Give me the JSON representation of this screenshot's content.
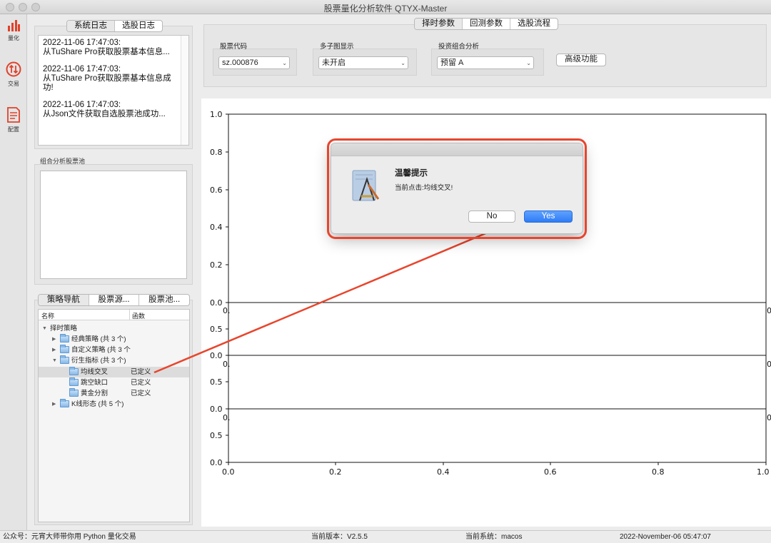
{
  "window": {
    "title": "股票量化分析软件 QTYX-Master"
  },
  "leftnav": [
    {
      "label": "量化",
      "icon": "bar-chart-icon"
    },
    {
      "label": "交易",
      "icon": "trade-arrows-icon"
    },
    {
      "label": "配置",
      "icon": "document-icon"
    }
  ],
  "log_tabs": [
    "系统日志",
    "选股日志"
  ],
  "log_entries": [
    {
      "time": "2022-11-06 17:47:03:",
      "msg": "从TuShare Pro获取股票基本信息..."
    },
    {
      "time": "2022-11-06 17:47:03:",
      "msg": "从TuShare Pro获取股票基本信息成",
      "msg2": "功!"
    },
    {
      "time": "2022-11-06 17:47:03:",
      "msg": "从Json文件获取自选股票池成功..."
    }
  ],
  "pool_label": "组合分析股票池",
  "nav_tabs": [
    "策略导航",
    "股票源...",
    "股票池..."
  ],
  "tree": {
    "headers": [
      "名称",
      "函数"
    ],
    "rows": [
      {
        "label": "择时策略",
        "fn": ""
      },
      {
        "label": "经典策略 (共 3 个)",
        "fn": ""
      },
      {
        "label": "自定义策略 (共 3 个",
        "fn": ""
      },
      {
        "label": "衍生指标 (共 3 个)",
        "fn": ""
      },
      {
        "label": "均线交叉",
        "fn": "已定义"
      },
      {
        "label": "跳空缺口",
        "fn": "已定义"
      },
      {
        "label": "黄金分割",
        "fn": "已定义"
      },
      {
        "label": "K线形态 (共 5 个)",
        "fn": ""
      }
    ]
  },
  "param_tabs": [
    "择时参数",
    "回测参数",
    "选股流程"
  ],
  "params": {
    "stock_code_label": "股票代码",
    "stock_code_value": "sz.000876",
    "subplot_label": "多子图显示",
    "subplot_value": "未开启",
    "portfolio_label": "投资组合分析",
    "portfolio_value": "预留 A",
    "advanced_button": "高级功能"
  },
  "chart_ticks": {
    "top_y": [
      "1.0",
      "0.8",
      "0.6",
      "0.4",
      "0.2",
      "0.0"
    ],
    "sub_y": [
      "0.5",
      "0.0"
    ],
    "x": [
      "0.0",
      "0.2",
      "0.4",
      "0.6",
      "0.8",
      "1.0"
    ],
    "edge_left": "0.",
    "edge_right": "0"
  },
  "dialog": {
    "title": "温馨提示",
    "message": "当前点击:均线交叉!",
    "no_label": "No",
    "yes_label": "Yes"
  },
  "status": {
    "wechat": "公众号：元宵大师带你用 Python 量化交易",
    "version": "当前版本：V2.5.5",
    "system": "当前系统：macos",
    "datetime": "2022-November-06 05:47:07"
  },
  "colors": {
    "accent": "#2f7bf5",
    "annotation": "#e8452d"
  }
}
